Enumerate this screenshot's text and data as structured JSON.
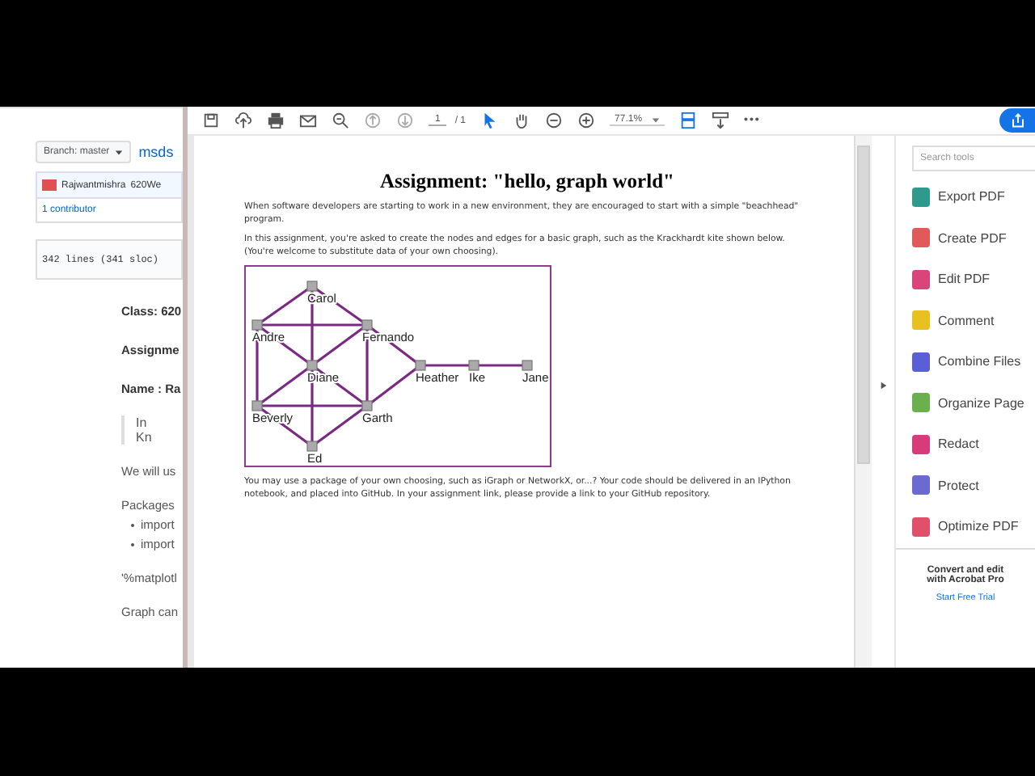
{
  "github": {
    "branch_button": "Branch: master",
    "repo_link": "msds",
    "commit": {
      "author": "Rajwantmishra",
      "message": "620We"
    },
    "contributors": "1 contributor",
    "file_info": "342 lines (341 sloc)",
    "notebook": [
      {
        "kind": "heading",
        "text": "Class: 620"
      },
      {
        "kind": "heading",
        "text": "Assignme"
      },
      {
        "kind": "heading",
        "text": "Name : Ra"
      },
      {
        "kind": "quote",
        "lines": [
          "In",
          "Kn"
        ]
      },
      {
        "kind": "para",
        "text": "We will us"
      },
      {
        "kind": "para",
        "text": "Packages"
      },
      {
        "kind": "bullet",
        "text": "import"
      },
      {
        "kind": "bullet",
        "text": "import"
      },
      {
        "kind": "para",
        "text": "'%matplotl"
      },
      {
        "kind": "para",
        "text": "Graph can"
      }
    ]
  },
  "toolbar": {
    "page_current": "1",
    "page_total": "/ 1",
    "zoom": "77.1%",
    "more": "•••"
  },
  "document": {
    "title": "Assignment:  \"hello, graph world\"",
    "paragraphs": [
      "When software developers are starting to work in a new environment, they are encouraged to start with a simple \"beachhead\" program.",
      "In this assignment, you're asked to create the nodes and edges for a basic graph, such as the Krackhardt kite shown below.  (You're welcome to substitute data of your own choosing).",
      "You may use a package of your own choosing, such as iGraph or NetworkX, or...?  Your code should be delivered in an IPython notebook, and placed into GitHub.  In your assignment link, please provide a link to your GitHub repository."
    ],
    "graph_nodes": [
      "Carol",
      "Andre",
      "Fernando",
      "Diane",
      "Heather",
      "Ike",
      "Jane",
      "Beverly",
      "Garth",
      "Ed"
    ]
  },
  "tools": {
    "search": {
      "placeholder": "Search tools"
    },
    "items": [
      {
        "label": "Export PDF",
        "color": "#2d9a8c"
      },
      {
        "label": "Create PDF",
        "color": "#e05a5a"
      },
      {
        "label": "Edit PDF",
        "color": "#d9447a"
      },
      {
        "label": "Comment",
        "color": "#e8c020"
      },
      {
        "label": "Combine Files",
        "color": "#5b5fd6"
      },
      {
        "label": "Organize Page",
        "color": "#6ab04c"
      },
      {
        "label": "Redact",
        "color": "#d93a7a"
      },
      {
        "label": "Protect",
        "color": "#6a6ad0"
      },
      {
        "label": "Optimize PDF",
        "color": "#e0506a"
      }
    ],
    "promo": [
      "Convert and edit",
      "with Acrobat Pro"
    ],
    "trial_link": "Start Free Trial"
  }
}
